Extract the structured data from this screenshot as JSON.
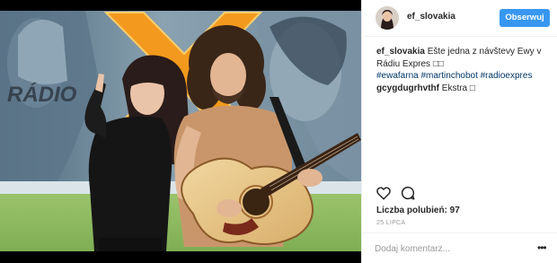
{
  "post": {
    "username": "ef_slovakia",
    "follow_label": "Obserwuj",
    "photo": {
      "description_icon": "photo",
      "studio_sign": "RÁDIO"
    },
    "comments": [
      {
        "username": "ef_slovakia",
        "text": "Ešte jedna z návštevy Ewy v Rádiu Expres",
        "emoji": "□□",
        "hashtags": "#ewafarna #martinchobot #radioexpres"
      },
      {
        "username": "gcygdugrhvthf",
        "text": "Ekstra",
        "emoji": "□"
      }
    ],
    "likes": "Liczba polubień: 97",
    "date": "25 LIPCA",
    "add_comment_placeholder": "Dodaj komentarz...",
    "more_label": "•••"
  },
  "colors": {
    "follow_button": "#3897f0",
    "hashtag": "#003569",
    "meta_gray": "#999999",
    "border": "#efefef",
    "logo_orange": "#f39a1e"
  },
  "icons": [
    "heart-icon",
    "comment-icon",
    "more-options-icon"
  ]
}
